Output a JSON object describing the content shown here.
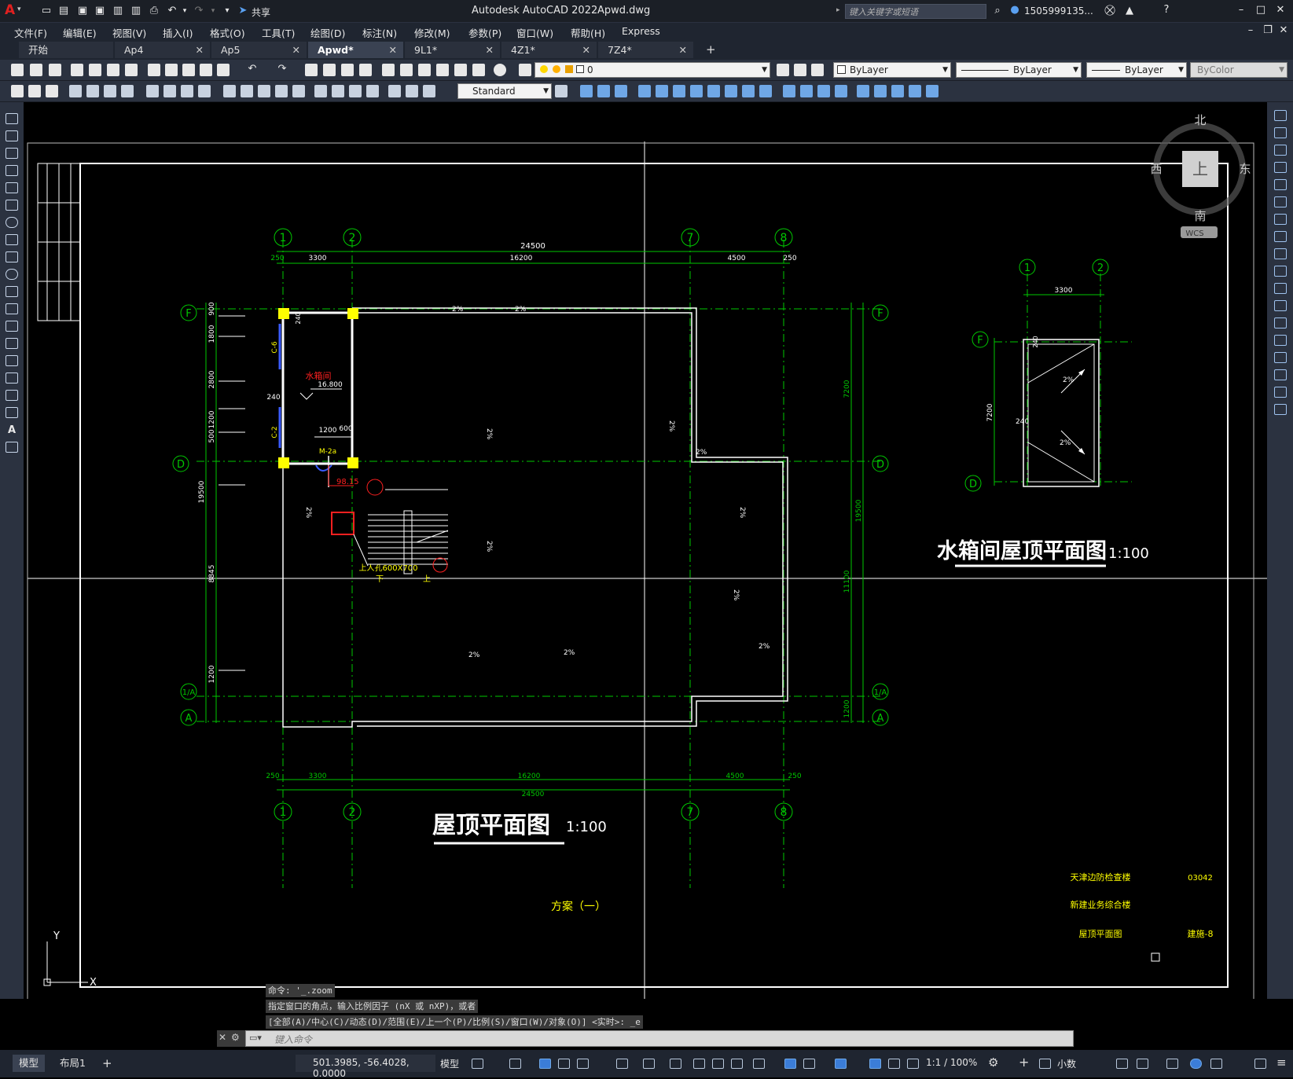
{
  "titlebar": {
    "app_title": "Autodesk AutoCAD 2022",
    "file_name": "Apwd.dwg",
    "share_label": "共享",
    "search_placeholder": "键入关键字或短语",
    "user_name": "1505999135...",
    "logo_letter": "A"
  },
  "menu": [
    "文件(F)",
    "编辑(E)",
    "视图(V)",
    "插入(I)",
    "格式(O)",
    "工具(T)",
    "绘图(D)",
    "标注(N)",
    "修改(M)",
    "参数(P)",
    "窗口(W)",
    "帮助(H)",
    "Express"
  ],
  "tabs": [
    {
      "label": "开始",
      "active": false,
      "closable": false
    },
    {
      "label": "Ap4",
      "active": false,
      "closable": true
    },
    {
      "label": "Ap5",
      "active": false,
      "closable": true
    },
    {
      "label": "Apwd*",
      "active": true,
      "closable": true
    },
    {
      "label": "9L1*",
      "active": false,
      "closable": true
    },
    {
      "label": "4Z1*",
      "active": false,
      "closable": true
    },
    {
      "label": "7Z4*",
      "active": false,
      "closable": true
    }
  ],
  "toolbar": {
    "layer_value": "0",
    "color_value": "ByLayer",
    "linetype_value": "ByLayer",
    "lineweight_value": "ByLayer",
    "plotstyle_value": "ByColor",
    "textstyle_value": "Standard"
  },
  "viewcube": {
    "north": "北",
    "south": "南",
    "east": "东",
    "west": "西",
    "top": "上",
    "wcs": "WCS"
  },
  "drawing": {
    "grid_labels_top": [
      "1",
      "2",
      "7",
      "8"
    ],
    "grid_labels_left": [
      "F",
      "D",
      "1/A",
      "A"
    ],
    "grid_labels_right": [
      "F",
      "D",
      "1/A",
      "A"
    ],
    "dims_top_total": "24500",
    "dims_top": [
      "250",
      "3300",
      "16200",
      "4500",
      "250"
    ],
    "dims_bottom": [
      "250",
      "3300",
      "16200",
      "4500",
      "250"
    ],
    "dims_bottom_total": "24500",
    "dims_left": [
      "900",
      "1800",
      "2800",
      "1200",
      "500",
      "19500",
      "8845",
      "1200"
    ],
    "dims_right": [
      "7200",
      "19500",
      "11100",
      "1200"
    ],
    "slopes": [
      "2%",
      "2%",
      "2%",
      "2%",
      "2%",
      "2%",
      "2%",
      "2%",
      "2%",
      "2%",
      "2%",
      "2%",
      "2%"
    ],
    "tank_label": "水箱间",
    "tank_elev": "16.800",
    "door_label": "M-2a",
    "win_label_1": "C-6",
    "win_label_2": "C-2",
    "dim_240": "240",
    "dim_1200": "1200",
    "dim_600": "600",
    "dim_240b": "240",
    "pipe_label": "98.15",
    "hatch_label": "上人孔600X700",
    "stair_down": "下",
    "stair_up": "上",
    "main_title": "屋顶平面图",
    "main_scale": "1:100",
    "detail_title": "水箱间屋顶平面图",
    "detail_scale": "1:100",
    "detail_grid_top": [
      "1",
      "2"
    ],
    "detail_grid_left": [
      "F",
      "D"
    ],
    "detail_dim_top": "3300",
    "detail_dim_left": "7200",
    "detail_dim_240a": "240",
    "detail_dim_240b": "240",
    "detail_slope_1": "2%",
    "detail_slope_2": "2%",
    "scheme_label": "方案（一）",
    "titleblock_project": "天津边防检查楼",
    "titleblock_building": "新建业务综合楼",
    "titleblock_sheet": "屋顶平面图",
    "titleblock_number": "03042",
    "titleblock_drawing_no": "建施-8",
    "ucs_y": "Y",
    "ucs_x": "X"
  },
  "command": {
    "history": [
      "命令: '_.zoom",
      "指定窗口的角点，输入比例因子 (nX 或 nXP)，或者",
      "[全部(A)/中心(C)/动态(D)/范围(E)/上一个(P)/比例(S)/窗口(W)/对象(O)] <实时>: _e"
    ],
    "placeholder": "键入命令"
  },
  "status": {
    "layout_tabs": [
      "模型",
      "布局1"
    ],
    "coords": "501.3985, -56.4028, 0.0000",
    "model_label": "模型",
    "scale": "1:1 / 100%",
    "units": "小数"
  },
  "colors": {
    "grid_green": "#00c800",
    "wall_white": "#ffffff",
    "text_yellow": "#ffff00",
    "red": "#ff2020",
    "blue": "#3a5cff",
    "bg": "#000000",
    "ui_dark": "#1f2530"
  }
}
